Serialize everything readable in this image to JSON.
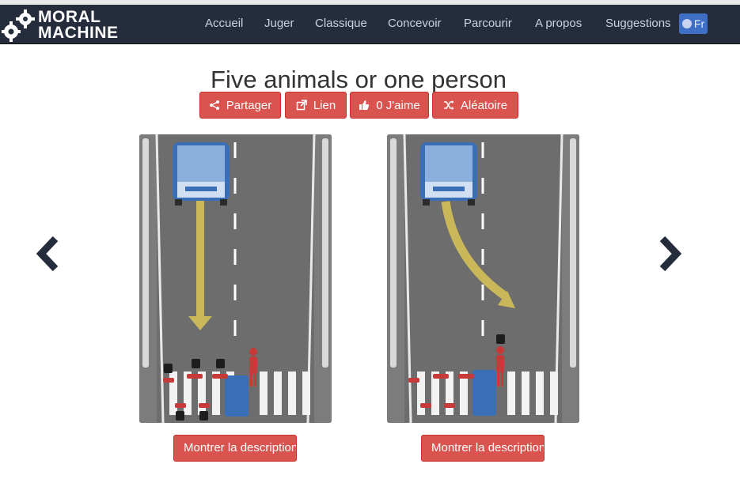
{
  "brand": {
    "line1": "MORAL",
    "line2": "MACHINE"
  },
  "nav": {
    "items": [
      {
        "label": "Accueil"
      },
      {
        "label": "Juger"
      },
      {
        "label": "Classique"
      },
      {
        "label": "Concevoir"
      },
      {
        "label": "Parcourir"
      },
      {
        "label": "A propos"
      },
      {
        "label": "Suggestions"
      }
    ],
    "language": "Fr"
  },
  "scenario": {
    "title": "Five animals or one person"
  },
  "actions": {
    "share": "Partager",
    "link": "Lien",
    "like": "0 J'aime",
    "random": "Aléatoire"
  },
  "options": {
    "left_description_label": "Montrer la description",
    "right_description_label": "Montrer la description"
  },
  "colors": {
    "navbar": "#252c3b",
    "accent_red": "#d9534f",
    "road": "#6d6d6d",
    "vehicle_blue": "#3a6fb8",
    "arrow_yellow": "#c9b75a",
    "victim_red": "#c83a3a"
  },
  "icons": {
    "logo": "gear-logo-icon",
    "share": "share-icon",
    "link": "external-link-icon",
    "like": "thumbs-up-icon",
    "random": "shuffle-icon",
    "prev": "chevron-left-icon",
    "next": "chevron-right-icon",
    "language": "globe-icon"
  }
}
